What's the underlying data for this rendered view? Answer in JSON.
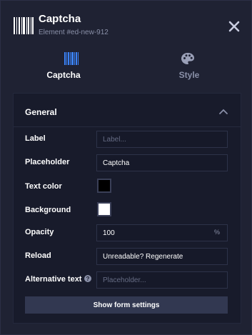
{
  "header": {
    "title": "Captcha",
    "subtitle": "Element #ed-new-912",
    "icon": "barcode-icon"
  },
  "tabs": [
    {
      "label": "Captcha",
      "icon": "barcode-icon",
      "active": true
    },
    {
      "label": "Style",
      "icon": "palette-icon",
      "active": false
    }
  ],
  "section": {
    "title": "General",
    "fields": {
      "label": {
        "label": "Label",
        "value": "",
        "placeholder": "Label..."
      },
      "placeholder": {
        "label": "Placeholder",
        "value": "Captcha"
      },
      "text_color": {
        "label": "Text color",
        "color": "#000000"
      },
      "background": {
        "label": "Background",
        "color": "#ffffff"
      },
      "opacity": {
        "label": "Opacity",
        "value": "100",
        "unit": "%"
      },
      "reload": {
        "label": "Reload",
        "value": "Unreadable? Regenerate"
      },
      "alt_text": {
        "label": "Alternative text",
        "value": "",
        "placeholder": "Placeholder..."
      }
    },
    "button_label": "Show form settings"
  },
  "colors": {
    "panel_bg": "#1f2233",
    "card_bg": "#181b2b",
    "accent": "#3b82f6",
    "button_bg": "#323851"
  }
}
